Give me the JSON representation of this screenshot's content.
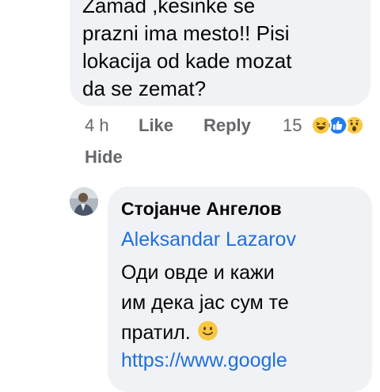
{
  "comment_top": {
    "text_lines": [
      "Zamad ,kesinke se",
      "prazni ima mesto!! Pisi",
      "lokacija od kade mozat",
      "da se zemat?"
    ],
    "time": "4 h",
    "like_label": "Like",
    "reply_label": "Reply",
    "hide_label": "Hide",
    "reaction_count": "15",
    "reactions": [
      "haha-icon",
      "like-icon",
      "wow-icon"
    ]
  },
  "reply_comment": {
    "author": "Стојанче Ангелов",
    "mention": "Aleksandar Lazarov",
    "text_lines": [
      "Оди овде и кажи",
      "им дека јас сум те",
      "пратил."
    ],
    "emoji": "slightly-smiling-face-icon",
    "link": "https://www.google"
  },
  "colors": {
    "bubble_bg": "#f0f2f5",
    "link_blue": "#216fdb",
    "meta_gray": "#65676b",
    "text": "#050505"
  }
}
